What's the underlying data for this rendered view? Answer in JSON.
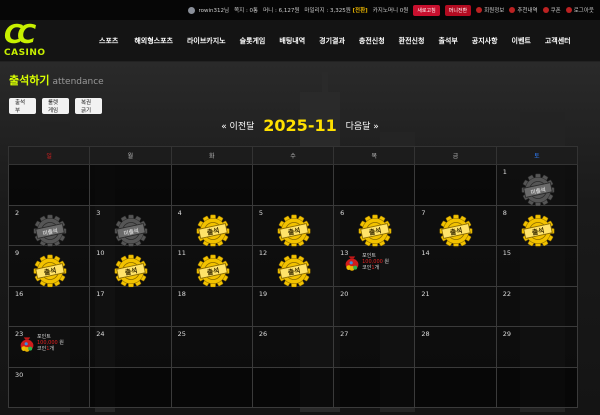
{
  "topbar": {
    "username": "rowin312님",
    "level": "",
    "points_label": "쪽지 : 0통",
    "money": "머니 : 6,127원",
    "mileage": "마일리지 : 3,325원",
    "mileage_suffix": "[전환]",
    "casino_money": "카지노머니 0원",
    "btn_refresh": "새로고침",
    "btn_money_convert": "머니전환",
    "member_info": "회원정보",
    "recommend": "추천내역",
    "coupon": "쿠폰",
    "logout": "로그아웃"
  },
  "logo": {
    "mark": "CC",
    "text": "CASINO"
  },
  "nav": [
    "스포츠",
    "해외형스포츠",
    "라이브카지노",
    "슬롯게임",
    "배팅내역",
    "경기결과",
    "충전신청",
    "환전신청",
    "출석부",
    "공지사항",
    "이벤트",
    "고객센터"
  ],
  "page": {
    "title": "출석하기",
    "subtitle": "attendance"
  },
  "tabs": [
    "출석부",
    "룰렛게임",
    "복권긁기"
  ],
  "month_nav": {
    "prev": "« 이전달",
    "year_month": "2025-11",
    "next": "다음달 »"
  },
  "calendar": {
    "headers": [
      "일",
      "월",
      "화",
      "수",
      "목",
      "금",
      "토"
    ],
    "stamp_attend": "출석",
    "stamp_absent": "미출석",
    "weeks": [
      [
        {
          "d": ""
        },
        {
          "d": ""
        },
        {
          "d": ""
        },
        {
          "d": ""
        },
        {
          "d": ""
        },
        {
          "d": ""
        },
        {
          "d": "1",
          "s": "absent"
        }
      ],
      [
        {
          "d": "2",
          "s": "absent"
        },
        {
          "d": "3",
          "s": "absent"
        },
        {
          "d": "4",
          "s": "attend"
        },
        {
          "d": "5",
          "s": "attend"
        },
        {
          "d": "6",
          "s": "attend"
        },
        {
          "d": "7",
          "s": "attend"
        },
        {
          "d": "8",
          "s": "attend"
        }
      ],
      [
        {
          "d": "9",
          "s": "attend"
        },
        {
          "d": "10",
          "s": "attend"
        },
        {
          "d": "11",
          "s": "attend"
        },
        {
          "d": "12",
          "s": "attend"
        },
        {
          "d": "13",
          "r": true
        },
        {
          "d": "14"
        },
        {
          "d": "15"
        }
      ],
      [
        {
          "d": "16"
        },
        {
          "d": "17"
        },
        {
          "d": "18"
        },
        {
          "d": "19"
        },
        {
          "d": "20"
        },
        {
          "d": "21"
        },
        {
          "d": "22"
        }
      ],
      [
        {
          "d": "23",
          "r": true
        },
        {
          "d": "24"
        },
        {
          "d": "25"
        },
        {
          "d": "26"
        },
        {
          "d": "27"
        },
        {
          "d": "28"
        },
        {
          "d": "29"
        }
      ],
      [
        {
          "d": "30"
        },
        {
          "d": ""
        },
        {
          "d": ""
        },
        {
          "d": ""
        },
        {
          "d": ""
        },
        {
          "d": ""
        },
        {
          "d": ""
        }
      ]
    ],
    "reward": {
      "line1": "포인트",
      "amount": "100,000",
      "unit": "원",
      "coin_prefix": "코인",
      "coin_count": "1",
      "coin_unit": "개"
    }
  },
  "colors": {
    "accent": "#d8ff00",
    "gold": "#ffe000",
    "sunday": "#e02020",
    "saturday": "#2f7fff"
  }
}
